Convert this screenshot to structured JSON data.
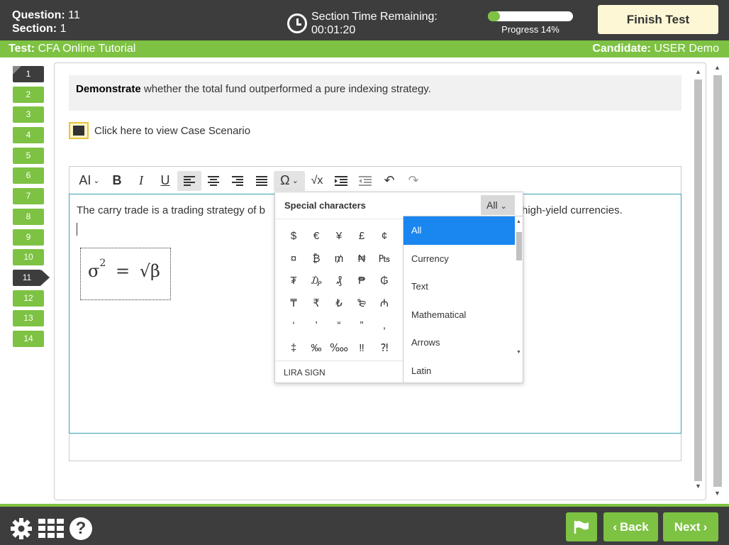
{
  "header": {
    "question_label": "Question:",
    "question_value": "11",
    "section_label": "Section:",
    "section_value": "1",
    "timer_label": "Section Time Remaining:",
    "timer_value": "00:01:20",
    "progress_label": "Progress 14%",
    "progress_fraction": 0.14,
    "finish_label": "Finish Test"
  },
  "subheader": {
    "test_label": "Test:",
    "test_value": "CFA Online Tutorial",
    "candidate_label": "Candidate:",
    "candidate_value": "USER Demo"
  },
  "questions": [
    "1",
    "2",
    "3",
    "4",
    "5",
    "6",
    "7",
    "8",
    "9",
    "10",
    "11",
    "12",
    "13",
    "14"
  ],
  "prompt": {
    "bold": "Demonstrate",
    "rest": " whether the total fund outperformed a pure indexing strategy."
  },
  "case_link": "Click here to view Case Scenario",
  "toolbar": {
    "font": "AI",
    "bold": "B",
    "italic": "I",
    "underline": "U",
    "special": "Ω",
    "formula": "√x"
  },
  "editor": {
    "text_start": "The carry trade is a trading strategy of b",
    "text_end": "high-yield currencies.",
    "formula_sigma": "σ",
    "formula_sup": "2",
    "formula_eq": "=",
    "formula_root": "√β"
  },
  "special_chars": {
    "title": "Special characters",
    "filter": "All",
    "footer": "LIRA SIGN",
    "rows": [
      [
        "$",
        "€",
        "¥",
        "£",
        "¢"
      ],
      [
        "¤",
        "₿",
        "₥",
        "₦",
        "₧"
      ],
      [
        "₮",
        "₯",
        "₰",
        "₱",
        "₲"
      ],
      [
        "₸",
        "₹",
        "₺",
        "₻",
        "₼"
      ],
      [
        "‘",
        "’",
        "“",
        "”",
        ","
      ],
      [
        "‡",
        "‰",
        "‱",
        "‼",
        "⁈"
      ]
    ],
    "options": [
      "All",
      "Currency",
      "Text",
      "Mathematical",
      "Arrows",
      "Latin"
    ]
  },
  "footer": {
    "back_label": "Back",
    "next_label": "Next",
    "help": "?"
  }
}
